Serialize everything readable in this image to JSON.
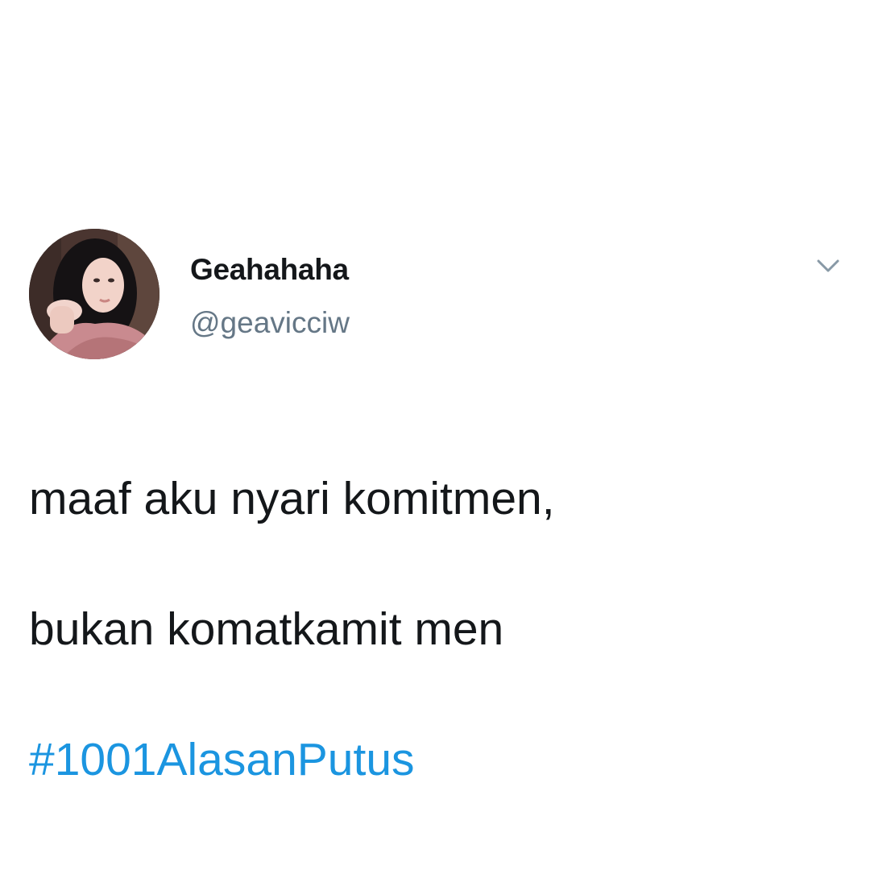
{
  "tweet": {
    "display_name": "Geahahaha",
    "handle": "@geavicciw",
    "text_lines": [
      "maaf aku nyari komitmen,",
      "bukan komatkamit men"
    ],
    "hashtag": "#1001AlasanPutus",
    "menu_icon": "chevron-down-icon",
    "avatar_icon": "profile-photo"
  },
  "colors": {
    "name": "#14171a",
    "handle": "#657786",
    "hashtag": "#1b95e0",
    "caret": "#8899a6"
  }
}
